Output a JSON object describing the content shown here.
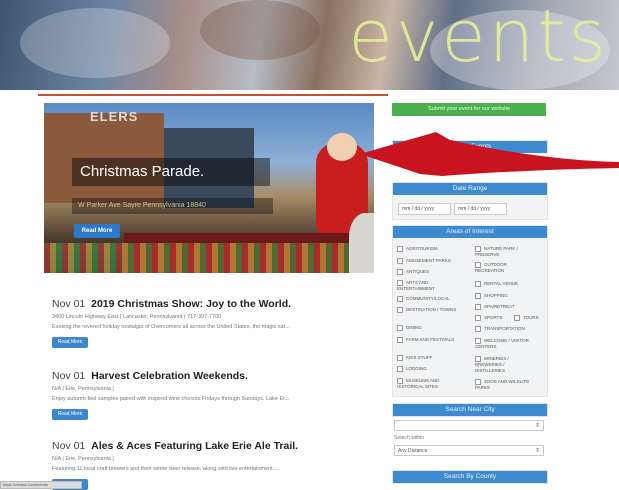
{
  "banner": {
    "title": "events"
  },
  "hero": {
    "sign_text": "ELERS",
    "title": "Christmas Parade.",
    "subtitle": "W Parker Ave Sayre Pennsylvania 18840",
    "button_label": "Read More"
  },
  "events": [
    {
      "date": "Nov 01",
      "name": "2019 Christmas Show: Joy to the World.",
      "location": "3400 Lincoln Highway East | Lancaster, Pennsylvania | 717-397-7700",
      "description": "Evoking the revered holiday nostalgia of Overcomers all across the United States, the magic sat...",
      "button_label": "Read More"
    },
    {
      "date": "Nov 01",
      "name": "Harvest Celebration Weekends.",
      "location": "N/A | Erie, Pennsylvania |",
      "description": "Enjoy autumn-feel samples paired with inspired wine choices Fridays through Sundays. Lake Er...",
      "button_label": "Read More"
    },
    {
      "date": "Nov 01",
      "name": "Ales & Aces Featuring Lake Erie Ale Trail.",
      "location": "N/A | Erie, Pennsylvania |",
      "description": "Featuring 11 local craft brewers and their winter beer release, along with live entertainment ...",
      "button_label": "Read More"
    }
  ],
  "sidebar": {
    "submit_label": "Submit your event for our website",
    "search_events_label": "Search Events",
    "date_range_label": "Date Range",
    "date_from_placeholder": "mm / dd / yyyy",
    "date_to_placeholder": "mm / dd / yyyy",
    "areas_label": "Areas of Interest",
    "interests_left": [
      "AGRITOURISM",
      "AMUSEMENT PARKS",
      "ANTIQUES",
      "ARTS AND ENTERTAINMENT",
      "COMMUNITY/LOCAL",
      "DESTINATION / TOWNS",
      "DINING",
      "FARM AND FESTIVALS",
      "KIDS STUFF",
      "LODGING",
      "MUSEUMS AND HISTORICAL SITES"
    ],
    "interests_right": [
      "NATURE PARK / PRESERVE",
      "OUTDOOR RECREATION",
      "RENTAL VENUE",
      "SHOPPING",
      "SPA/RETREAT",
      "SPORTS",
      "TOURS",
      "TRANSPORTATION",
      "WELCOME / VISITOR CENTERS",
      "WINERIES / BREWERIES / DISTILLERIES",
      "ZOOS AND WILDLIFE PARKS"
    ],
    "search_city_label": "Search Near City",
    "search_within_label": "Search within",
    "distance_value": "Any Distance",
    "search_county_label": "Search By County"
  },
  "status_bar": {
    "text": "https://visitpa.com/events"
  },
  "colors": {
    "accent_blue": "#3d8ad0",
    "submit_green": "#4caf50",
    "arrow_red": "#c8141e",
    "divider": "#c6502f"
  }
}
